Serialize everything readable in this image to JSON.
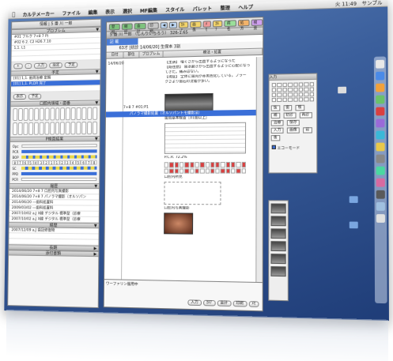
{
  "menubar": {
    "apple_icon": "apple-icon",
    "items": [
      "カルテメーカー",
      "ファイル",
      "編集",
      "表示",
      "選択",
      "MF編集",
      "スタイル",
      "パレット",
      "整理",
      "ヘルプ"
    ],
    "clock": "火 11:49",
    "user": "サンプル"
  },
  "left_panel": {
    "title": "情報 | 5 番 川 一郎",
    "patient_section": "プロブレム",
    "patient_rows": [
      "#01 フルク  7+8 7  P)",
      "#02  6 2.  C2  H26.7.10",
      "1,1.  L1"
    ],
    "buttons_a": [
      "+",
      "-",
      "入力",
      "設定",
      "予定"
    ],
    "plan_section": "予定",
    "plan_rows": [
      "[01]  1,1.  歯周治療 定期",
      "[01]  1,1.  PI,DR    完了"
    ],
    "buttons_b": [
      "表示",
      "予定"
    ],
    "oral_section": "口腔内領域・歯番",
    "perio_section": "P検査結果",
    "perio_labels": [
      "Opc",
      "PCR",
      "BOP",
      "SC",
      "PPD",
      "PCR"
    ],
    "perio_numbers": [
      "8",
      "7",
      "6",
      "5",
      "4",
      "3",
      "2",
      "1",
      "1",
      "2",
      "3",
      "4",
      "5",
      "6",
      "7",
      "8"
    ],
    "history_section": "履歴",
    "history_rows": [
      "2014/06/20  7+8 7  口腔内写真撮影",
      "2014/06/20  7+8 7  パノラマ撮影（オルソパン",
      "2014/06/20     ―歯科処置料",
      "2009/03/02     ―歯科処置料",
      "2007/10/02  a,J  X線 デジタル 標準型（診療",
      "2007/10/02  a,J  X線 デジタル 標準型（診療"
    ],
    "memo_section": "経歴",
    "memo_rows": [
      "2007/12/09  a,J  歯冠修復物"
    ],
    "footer_a": "長期",
    "footer_b": "添付書類"
  },
  "main_window": {
    "toolbar": [
      "登録",
      "継続",
      "会計",
      "印刷",
      "◀",
      "▶",
      "ｶﾙﾃ",
      "画像",
      "ﾒﾓ",
      "ｶﾙﾃ",
      "病名",
      "処方",
      "検査"
    ],
    "title": "5 番 川 一郎 （しんりいちろう） 326-1.65",
    "tab": "記 載",
    "info": "63才 [初診 14/06/20] 生保本 3割",
    "columns": [
      "日付",
      "部位",
      "プロブレム",
      "療法・処置"
    ],
    "date": "14/06/20",
    "tooth_code": "7+8 7",
    "problem_code": "#01:P1",
    "notes": [
      "【主訴】 噛ぐさから出血するようになった",
      "【既往歴】 歯茎磨きから出血するように心配になっ",
      "         てきた。痛みはない。",
      "【現症】 全体に歯肉が赤黒色化している。プラー",
      "         クさより歯石の沈着が多い。"
    ],
    "blue_row": "パノラマ撮影処置（オルソパントモ撮影法）",
    "perio_title": "歯周基本検査［01歯以上］",
    "pcr_label": "P.C.R. 72.2%",
    "oral_label": "口腔内所見",
    "photo_label": "口腔内写真撮影",
    "memo_text": "ワーファリン服用中",
    "memo_buttons": [
      "入力",
      "ｶﾙﾃ",
      "会計",
      "印刷",
      "ﾒﾓ"
    ]
  },
  "palette": {
    "title": "入力",
    "buttons": [
      "抜",
      "歯",
      "根",
      "補",
      "初診",
      "再診",
      "治療",
      "保存",
      "入力",
      "画像",
      "前",
      "後"
    ],
    "checkbox_label": "エコーモード"
  },
  "colors": {
    "accent_blue": "#3a6fd8",
    "perio_red": "#d94040",
    "desktop": "#3b5f9c"
  }
}
